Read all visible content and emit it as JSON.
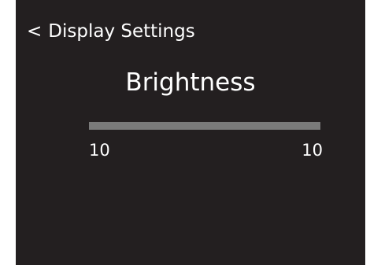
{
  "screen": {
    "background": "#231f20",
    "text_color": "#ffffff"
  },
  "navigation": {
    "back_icon": "<",
    "back_label": "Display Settings"
  },
  "brightness": {
    "title": "Brightness",
    "value": 10,
    "maximum": 10,
    "left_value_text": "10",
    "right_value_text": "10",
    "fill_fraction": 1
  }
}
